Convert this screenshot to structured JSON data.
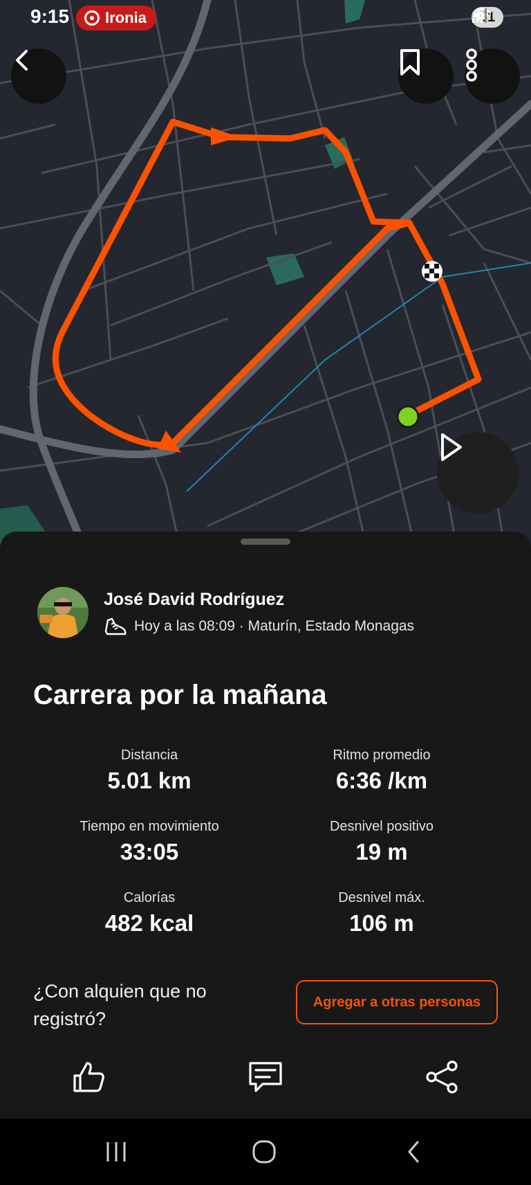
{
  "status_bar": {
    "time": "9:15",
    "recording_app": "Ironia",
    "battery": "61"
  },
  "map": {
    "route_color": "#fc5200",
    "start_marker_color": "#7ed321",
    "icons": [
      "back-icon",
      "bookmark-icon",
      "more-vertical-icon",
      "play-icon",
      "finish-flag-icon"
    ]
  },
  "athlete": {
    "name": "José David Rodríguez",
    "meta": "Hoy a las 08:09 · Maturín, Estado Monagas",
    "sport_icon": "running-shoe-icon"
  },
  "activity": {
    "title": "Carrera por la mañana"
  },
  "stats": [
    {
      "label": "Distancia",
      "value": "5.01 km"
    },
    {
      "label": "Ritmo promedio",
      "value": "6:36 /km"
    },
    {
      "label": "Tiempo en movimiento",
      "value": "33:05"
    },
    {
      "label": "Desnivel positivo",
      "value": "19 m"
    },
    {
      "label": "Calorías",
      "value": "482 kcal"
    },
    {
      "label": "Desnivel máx.",
      "value": "106 m"
    }
  ],
  "tag_prompt": {
    "question": "¿Con alquien que no registró?",
    "button": "Agregar a otras personas"
  },
  "actions": [
    "like-icon",
    "comment-icon",
    "share-icon"
  ],
  "colors": {
    "accent": "#fc5200",
    "sheet_background": "#181818",
    "map_background": "#24272f",
    "recording_pill": "#c81a1a"
  }
}
